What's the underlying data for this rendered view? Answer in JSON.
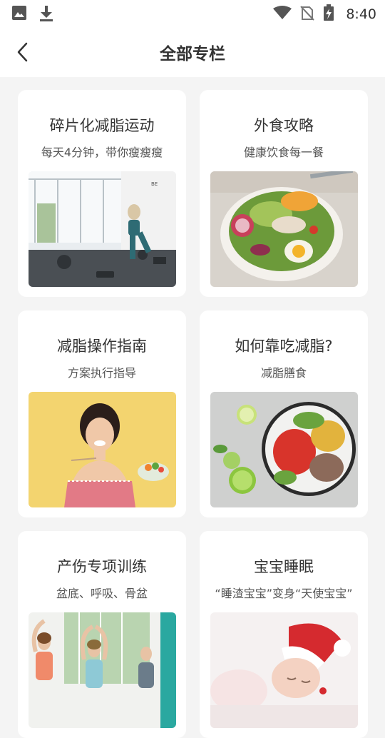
{
  "status_bar": {
    "left_icons": [
      "image-icon",
      "download-icon"
    ],
    "right_icons": [
      "wifi-icon",
      "no-sim-icon",
      "battery-charging-icon"
    ],
    "time": "8:40"
  },
  "header": {
    "title": "全部专栏",
    "back_icon": "chevron-left-icon"
  },
  "cards": [
    {
      "title": "碎片化减脂运动",
      "subtitle": "每天4分钟，带你瘦瘦瘦"
    },
    {
      "title": "外食攻略",
      "subtitle": "健康饮食每一餐"
    },
    {
      "title": "减脂操作指南",
      "subtitle": "方案执行指导"
    },
    {
      "title": "如何靠吃减脂?",
      "subtitle": "减脂膳食"
    },
    {
      "title": "产伤专项训练",
      "subtitle": "盆底、呼吸、骨盆"
    },
    {
      "title": "宝宝睡眠",
      "subtitle": "“睡渣宝宝”变身“天使宝宝”"
    }
  ],
  "colors": {
    "background": "#f4f4f4",
    "card": "#ffffff",
    "text": "#333333"
  }
}
